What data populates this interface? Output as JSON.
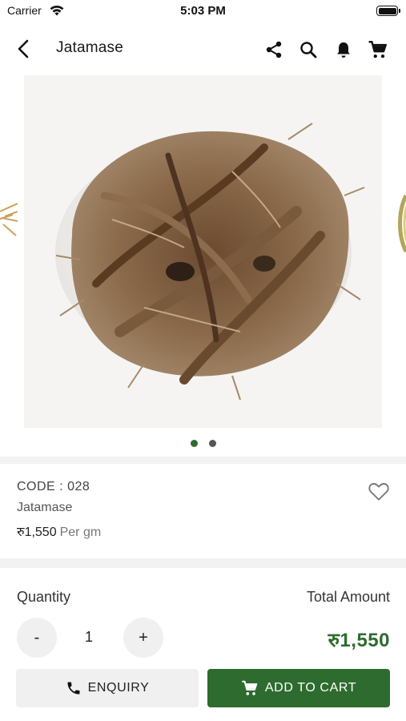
{
  "status_bar": {
    "carrier": "Carrier",
    "time": "5:03 PM"
  },
  "app_bar": {
    "title": "Jatamase",
    "icons": [
      "back-icon",
      "share-icon",
      "search-icon",
      "bell-icon",
      "cart-icon"
    ]
  },
  "carousel": {
    "image_subject": "dried jatamansi root",
    "slide_count": 2,
    "active_index": 0
  },
  "product": {
    "code": "CODE : 028",
    "name": "Jatamase",
    "price": "रु1,550",
    "unit": "Per gm"
  },
  "order": {
    "quantity_label": "Quantity",
    "total_label": "Total Amount",
    "decrement_label": "-",
    "quantity": "1",
    "increment_label": "+",
    "total_amount": "रु1,550"
  },
  "actions": {
    "enquiry_label": "ENQUIRY",
    "add_to_cart_label": "ADD TO CART"
  },
  "colors": {
    "accent": "#2e6b2e",
    "inactive_dot": "#555555",
    "button_gray": "#f0f0f0"
  }
}
